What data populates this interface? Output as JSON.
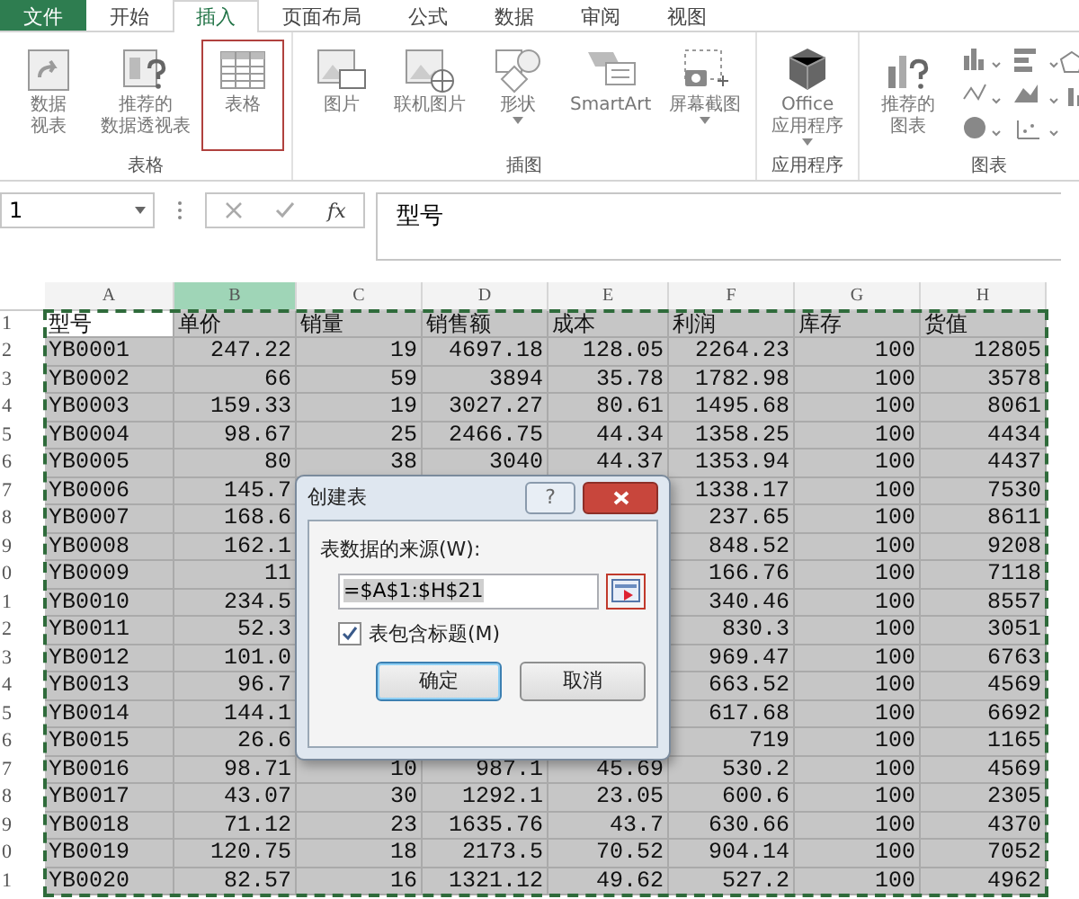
{
  "ribbon": {
    "tabs": [
      {
        "label": "文件",
        "kind": "file",
        "selected": false
      },
      {
        "label": "开始",
        "kind": "tab",
        "selected": false
      },
      {
        "label": "插入",
        "kind": "tab",
        "selected": true
      },
      {
        "label": "页面布局",
        "kind": "tab",
        "selected": false
      },
      {
        "label": "公式",
        "kind": "tab",
        "selected": false
      },
      {
        "label": "数据",
        "kind": "tab",
        "selected": false
      },
      {
        "label": "审阅",
        "kind": "tab",
        "selected": false
      },
      {
        "label": "视图",
        "kind": "tab",
        "selected": false
      }
    ],
    "groups": [
      {
        "label": "表格",
        "buttons": [
          {
            "kind": "pivot",
            "lines": [
              "数据",
              "视表"
            ],
            "highlighted": false,
            "dropdown": false
          },
          {
            "kind": "recommended-pivot",
            "lines": [
              "推荐的",
              "数据透视表"
            ],
            "highlighted": false,
            "dropdown": false
          },
          {
            "kind": "table",
            "lines": [
              "表格"
            ],
            "highlighted": true,
            "dropdown": false
          }
        ]
      },
      {
        "label": "插图",
        "buttons": [
          {
            "kind": "picture",
            "lines": [
              "图片"
            ],
            "highlighted": false,
            "dropdown": false
          },
          {
            "kind": "online-picture",
            "lines": [
              "联机图片"
            ],
            "highlighted": false,
            "dropdown": false
          },
          {
            "kind": "shapes",
            "lines": [
              "形状"
            ],
            "highlighted": false,
            "dropdown": true
          },
          {
            "kind": "smartart",
            "lines": [
              "SmartArt"
            ],
            "highlighted": false,
            "dropdown": false
          },
          {
            "kind": "screenshot",
            "lines": [
              "屏幕截图"
            ],
            "highlighted": false,
            "dropdown": true
          }
        ]
      },
      {
        "label": "应用程序",
        "buttons": [
          {
            "kind": "office",
            "lines": [
              "Office",
              "应用程序"
            ],
            "highlighted": false,
            "dropdown": true
          }
        ]
      },
      {
        "label": "图表",
        "buttons": [
          {
            "kind": "recommended-chart",
            "lines": [
              "推荐的",
              "图表"
            ],
            "highlighted": false,
            "dropdown": false
          },
          {
            "kind": "chart-gallery",
            "highlighted": false,
            "dropdown": false
          }
        ]
      }
    ]
  },
  "formula_bar": {
    "name_box": "1",
    "fx": "fx",
    "value": "型号"
  },
  "sheet": {
    "columns": [
      {
        "label": "A",
        "kind": "text",
        "selected": false
      },
      {
        "label": "B",
        "kind": "number",
        "selected": true
      },
      {
        "label": "C",
        "kind": "number",
        "selected": false
      },
      {
        "label": "D",
        "kind": "number",
        "selected": false
      },
      {
        "label": "E",
        "kind": "number",
        "selected": false
      },
      {
        "label": "F",
        "kind": "number",
        "selected": false
      },
      {
        "label": "G",
        "kind": "number",
        "selected": false
      },
      {
        "label": "H",
        "kind": "number",
        "selected": false
      }
    ],
    "rows": [
      {
        "number": "1",
        "kind": "header",
        "cells": [
          "型号",
          "单价",
          "销量",
          "销售额",
          "成本",
          "利润",
          "库存",
          "货值"
        ]
      },
      {
        "number": "2",
        "kind": "data",
        "cells": [
          "YB0001",
          "247.22",
          "19",
          "4697.18",
          "128.05",
          "2264.23",
          "100",
          "12805"
        ]
      },
      {
        "number": "3",
        "kind": "data",
        "cells": [
          "YB0002",
          "66",
          "59",
          "3894",
          "35.78",
          "1782.98",
          "100",
          "3578"
        ]
      },
      {
        "number": "4",
        "kind": "data",
        "cells": [
          "YB0003",
          "159.33",
          "19",
          "3027.27",
          "80.61",
          "1495.68",
          "100",
          "8061"
        ]
      },
      {
        "number": "5",
        "kind": "data",
        "cells": [
          "YB0004",
          "98.67",
          "25",
          "2466.75",
          "44.34",
          "1358.25",
          "100",
          "4434"
        ]
      },
      {
        "number": "6",
        "kind": "data",
        "cells": [
          "YB0005",
          "80",
          "38",
          "3040",
          "44.37",
          "1353.94",
          "100",
          "4437"
        ]
      },
      {
        "number": "7",
        "kind": "data",
        "cells": [
          "YB0006",
          "145.7",
          null,
          null,
          null,
          "1338.17",
          "100",
          "7530"
        ]
      },
      {
        "number": "8",
        "kind": "data",
        "cells": [
          "YB0007",
          "168.6",
          null,
          null,
          null,
          "237.65",
          "100",
          "8611"
        ]
      },
      {
        "number": "9",
        "kind": "data",
        "cells": [
          "YB0008",
          "162.1",
          null,
          null,
          null,
          "848.52",
          "100",
          "9208"
        ]
      },
      {
        "number": "0",
        "kind": "data",
        "cells": [
          "YB0009",
          "11",
          null,
          null,
          null,
          "166.76",
          "100",
          "7118"
        ]
      },
      {
        "number": "1",
        "kind": "data",
        "cells": [
          "YB0010",
          "234.5",
          null,
          null,
          null,
          "340.46",
          "100",
          "8557"
        ]
      },
      {
        "number": "2",
        "kind": "data",
        "cells": [
          "YB0011",
          "52.3",
          null,
          null,
          null,
          "830.3",
          "100",
          "3051"
        ]
      },
      {
        "number": "3",
        "kind": "data",
        "cells": [
          "YB0012",
          "101.0",
          null,
          null,
          null,
          "969.47",
          "100",
          "6763"
        ]
      },
      {
        "number": "4",
        "kind": "data",
        "cells": [
          "YB0013",
          "96.7",
          null,
          null,
          null,
          "663.52",
          "100",
          "4569"
        ]
      },
      {
        "number": "5",
        "kind": "data",
        "cells": [
          "YB0014",
          "144.1",
          null,
          null,
          null,
          "617.68",
          "100",
          "6692"
        ]
      },
      {
        "number": "6",
        "kind": "data",
        "cells": [
          "YB0015",
          "26.6",
          null,
          null,
          null,
          "719",
          "100",
          "1165"
        ]
      },
      {
        "number": "7",
        "kind": "data",
        "cells": [
          "YB0016",
          "98.71",
          "10",
          "987.1",
          "45.69",
          "530.2",
          "100",
          "4569"
        ]
      },
      {
        "number": "8",
        "kind": "data",
        "cells": [
          "YB0017",
          "43.07",
          "30",
          "1292.1",
          "23.05",
          "600.6",
          "100",
          "2305"
        ]
      },
      {
        "number": "9",
        "kind": "data",
        "cells": [
          "YB0018",
          "71.12",
          "23",
          "1635.76",
          "43.7",
          "630.66",
          "100",
          "4370"
        ]
      },
      {
        "number": "0",
        "kind": "data",
        "cells": [
          "YB0019",
          "120.75",
          "18",
          "2173.5",
          "70.52",
          "904.14",
          "100",
          "7052"
        ]
      },
      {
        "number": "1",
        "kind": "data",
        "cells": [
          "YB0020",
          "82.57",
          "16",
          "1321.12",
          "49.62",
          "527.2",
          "100",
          "4962"
        ]
      }
    ]
  },
  "dialog": {
    "title": "创建表",
    "help": "?",
    "source_label": "表数据的来源(W):",
    "source_value": "=$A$1:$H$21",
    "range_button_highlighted": true,
    "checkbox": {
      "label": "表包含标题(M)",
      "checked": true
    },
    "buttons": [
      {
        "label": "确定",
        "kind": "default"
      },
      {
        "label": "取消",
        "kind": "normal"
      }
    ]
  }
}
